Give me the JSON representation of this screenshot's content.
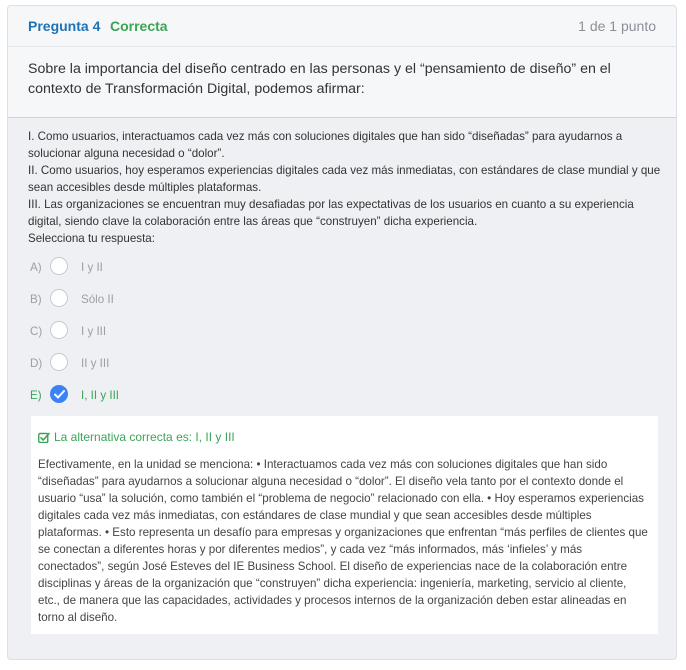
{
  "header": {
    "question_label": "Pregunta 4",
    "status": "Correcta",
    "points": "1 de 1 punto"
  },
  "question": {
    "text": "Sobre la importancia del diseño centrado en las personas y el “pensamiento de diseño” en el contexto de Transformación Digital, podemos afirmar:"
  },
  "statements": [
    "I. Como usuarios, interactuamos cada vez más con soluciones digitales que han sido “diseñadas” para ayudarnos a solucionar alguna necesidad o “dolor”.",
    "II. Como usuarios, hoy esperamos experiencias digitales cada vez más inmediatas, con estándares de clase mundial y que sean accesibles desde múltiples plataformas.",
    "III. Las organizaciones se encuentran muy desafiadas por las expectativas de los usuarios en cuanto a su experiencia digital, siendo clave la colaboración entre las áreas que “construyen” dicha experiencia."
  ],
  "prompt": "Selecciona tu respuesta:",
  "options": [
    {
      "letter": "A)",
      "text": "I y II",
      "selected": false
    },
    {
      "letter": "B)",
      "text": "Sólo II",
      "selected": false
    },
    {
      "letter": "C)",
      "text": "I y III",
      "selected": false
    },
    {
      "letter": "D)",
      "text": "II y III",
      "selected": false
    },
    {
      "letter": "E)",
      "text": "I, II y III",
      "selected": true
    }
  ],
  "feedback": {
    "title": "La alternativa correcta es: I, II y III",
    "body": "Efectivamente, en la unidad se menciona: • Interactuamos cada vez más con soluciones digitales que han sido “diseñadas” para ayudarnos a solucionar alguna necesidad o “dolor”. El diseño vela tanto por el contexto donde el usuario “usa” la solución, como también el “problema de negocio” relacionado con ella. • Hoy esperamos experiencias digitales cada vez más inmediatas, con estándares de clase mundial y que sean accesibles desde múltiples plataformas. • Esto representa un desafío para empresas y organizaciones que enfrentan “más perfiles de clientes que se conectan a diferentes horas y por diferentes medios”, y cada vez “más informados, más ‘infieles’ y más conectados”, según José Esteves del IE Business School. El diseño de experiencias nace de la colaboración entre disciplinas y áreas de la organización que “construyen” dicha experiencia: ingeniería, marketing, servicio al cliente, etc., de manera que las capacidades, actividades y procesos internos de la organización deben estar alineadas en torno al diseño."
  },
  "colors": {
    "accent_blue": "#1e73b8",
    "correct_green": "#3aa556",
    "checked_radio": "#3b82f6"
  }
}
